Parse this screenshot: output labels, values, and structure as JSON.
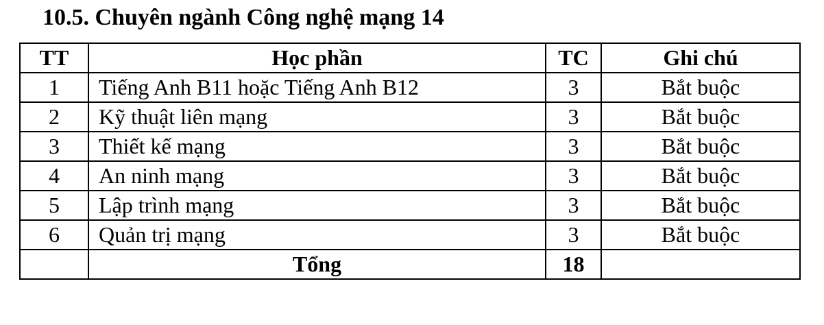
{
  "heading": "10.5. Chuyên ngành Công nghệ mạng 14",
  "table": {
    "headers": {
      "tt": "TT",
      "name": "Học phần",
      "tc": "TC",
      "note": "Ghi chú"
    },
    "rows": [
      {
        "tt": "1",
        "name": "Tiếng Anh B11 hoặc Tiếng Anh B12",
        "tc": "3",
        "note": "Bắt buộc"
      },
      {
        "tt": "2",
        "name": "Kỹ thuật liên mạng",
        "tc": "3",
        "note": "Bắt buộc"
      },
      {
        "tt": "3",
        "name": "Thiết kế mạng",
        "tc": "3",
        "note": "Bắt buộc"
      },
      {
        "tt": "4",
        "name": "An ninh mạng",
        "tc": "3",
        "note": "Bắt buộc"
      },
      {
        "tt": "5",
        "name": "Lập trình mạng",
        "tc": "3",
        "note": "Bắt buộc"
      },
      {
        "tt": "6",
        "name": "Quản trị mạng",
        "tc": "3",
        "note": "Bắt buộc"
      }
    ],
    "total": {
      "label": "Tổng",
      "tc": "18"
    }
  }
}
